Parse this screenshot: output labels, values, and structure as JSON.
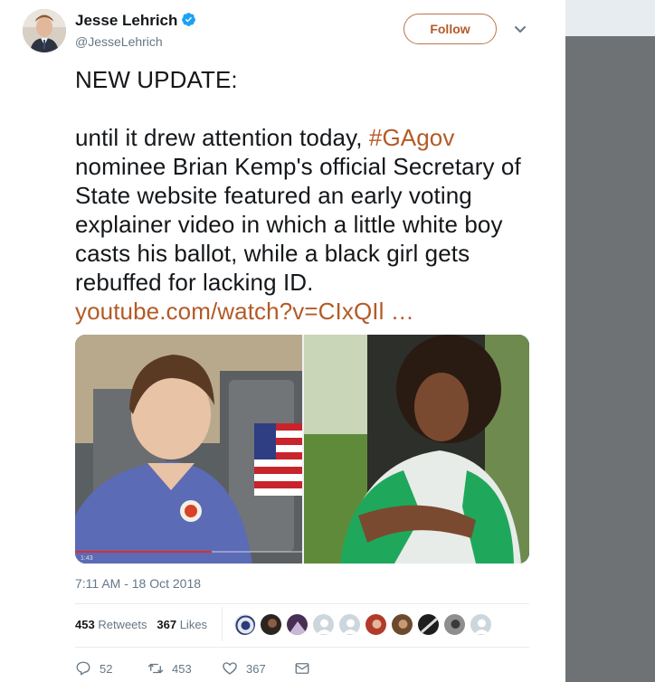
{
  "colors": {
    "accent": "#b45a26",
    "text": "#14171a",
    "muted": "#657786",
    "verified": "#1da1f2"
  },
  "author": {
    "name": "Jesse Lehrich",
    "handle": "@JesseLehrich",
    "verified_icon": "verified-badge-icon"
  },
  "follow_label": "Follow",
  "tweet": {
    "line_intro": "NEW UPDATE:",
    "text_before_hashtag": "until it drew attention today, ",
    "hashtag": "#GAgov",
    "text_after_hashtag": " nominee Brian Kemp's official Secretary of State website featured an early voting explainer video in which a little white boy casts his ballot, while a black girl gets rebuffed for lacking ID.",
    "link": "youtube.com/watch?v=CIxQIl …"
  },
  "media": {
    "timecode": "1:43",
    "progress": 0.6
  },
  "timestamp": "7:11 AM - 18 Oct 2018",
  "stats": {
    "retweets_count": "453",
    "retweets_label": "Retweets",
    "likes_count": "367",
    "likes_label": "Likes"
  },
  "actions": {
    "replies": "52",
    "retweets": "453",
    "likes": "367"
  }
}
